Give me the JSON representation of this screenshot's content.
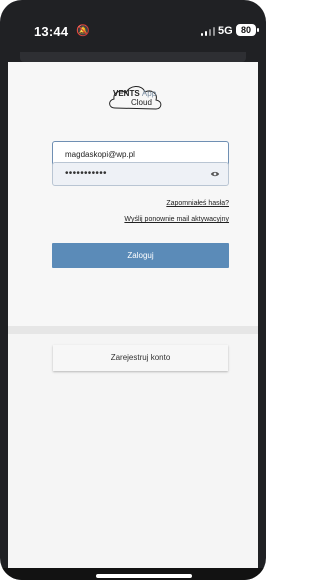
{
  "status_bar": {
    "time": "13:44",
    "network": "5G",
    "battery": "80"
  },
  "logo": {
    "brand": "VENTS",
    "app": "App",
    "cloud": "Cloud"
  },
  "login_form": {
    "email_value": "magdaskopi@wp.pl",
    "password_mask": "•••••••••••",
    "forgot_password_link": "Zapomniałeś hasła?",
    "resend_activation_link": "Wyślij ponownie mail aktywacyjny",
    "login_button": "Zaloguj"
  },
  "register": {
    "register_button": "Zarejestruj konto"
  },
  "colors": {
    "primary": "#5b8bb8",
    "background": "#f7f7f7",
    "input_border": "#6f8fb3"
  },
  "icons": {
    "eye": "eye-icon",
    "mute": "bell-slash-icon",
    "signal": "signal-icon",
    "battery": "battery-icon"
  }
}
